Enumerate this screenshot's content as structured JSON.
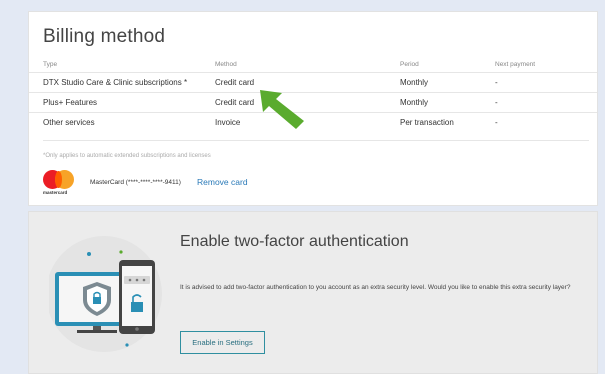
{
  "billing": {
    "title": "Billing method",
    "columns": [
      "Type",
      "Method",
      "Period",
      "Next payment"
    ],
    "rows": [
      {
        "type": "DTX Studio Care & Clinic subscriptions *",
        "method": "Credit card",
        "period": "Monthly",
        "next": "-"
      },
      {
        "type": "Plus+ Features",
        "method": "Credit card",
        "period": "Monthly",
        "next": "-"
      },
      {
        "type": "Other services",
        "method": "Invoice",
        "period": "Per transaction",
        "next": "-"
      }
    ],
    "footnote": "*Only applies to automatic extended subscriptions and licenses",
    "card": {
      "brand": "mastercard",
      "number_label": "MasterCard (****-****-****-9411)",
      "remove_label": "Remove card"
    }
  },
  "two_factor": {
    "title": "Enable two-factor authentication",
    "description": "It is advised to add two-factor authentication to you account as an extra security level. Would you like to enable this extra security layer?",
    "button_label": "Enable in Settings"
  },
  "colors": {
    "arrow": "#5aab2e",
    "link": "#2a7ab8",
    "button_border": "#2f8fa0",
    "page_bg": "#e3e9f4",
    "illustration_accent": "#2a8fb5"
  },
  "icons": [
    "arrow-pointer-icon",
    "mastercard-logo-icon",
    "security-devices-illustration"
  ]
}
